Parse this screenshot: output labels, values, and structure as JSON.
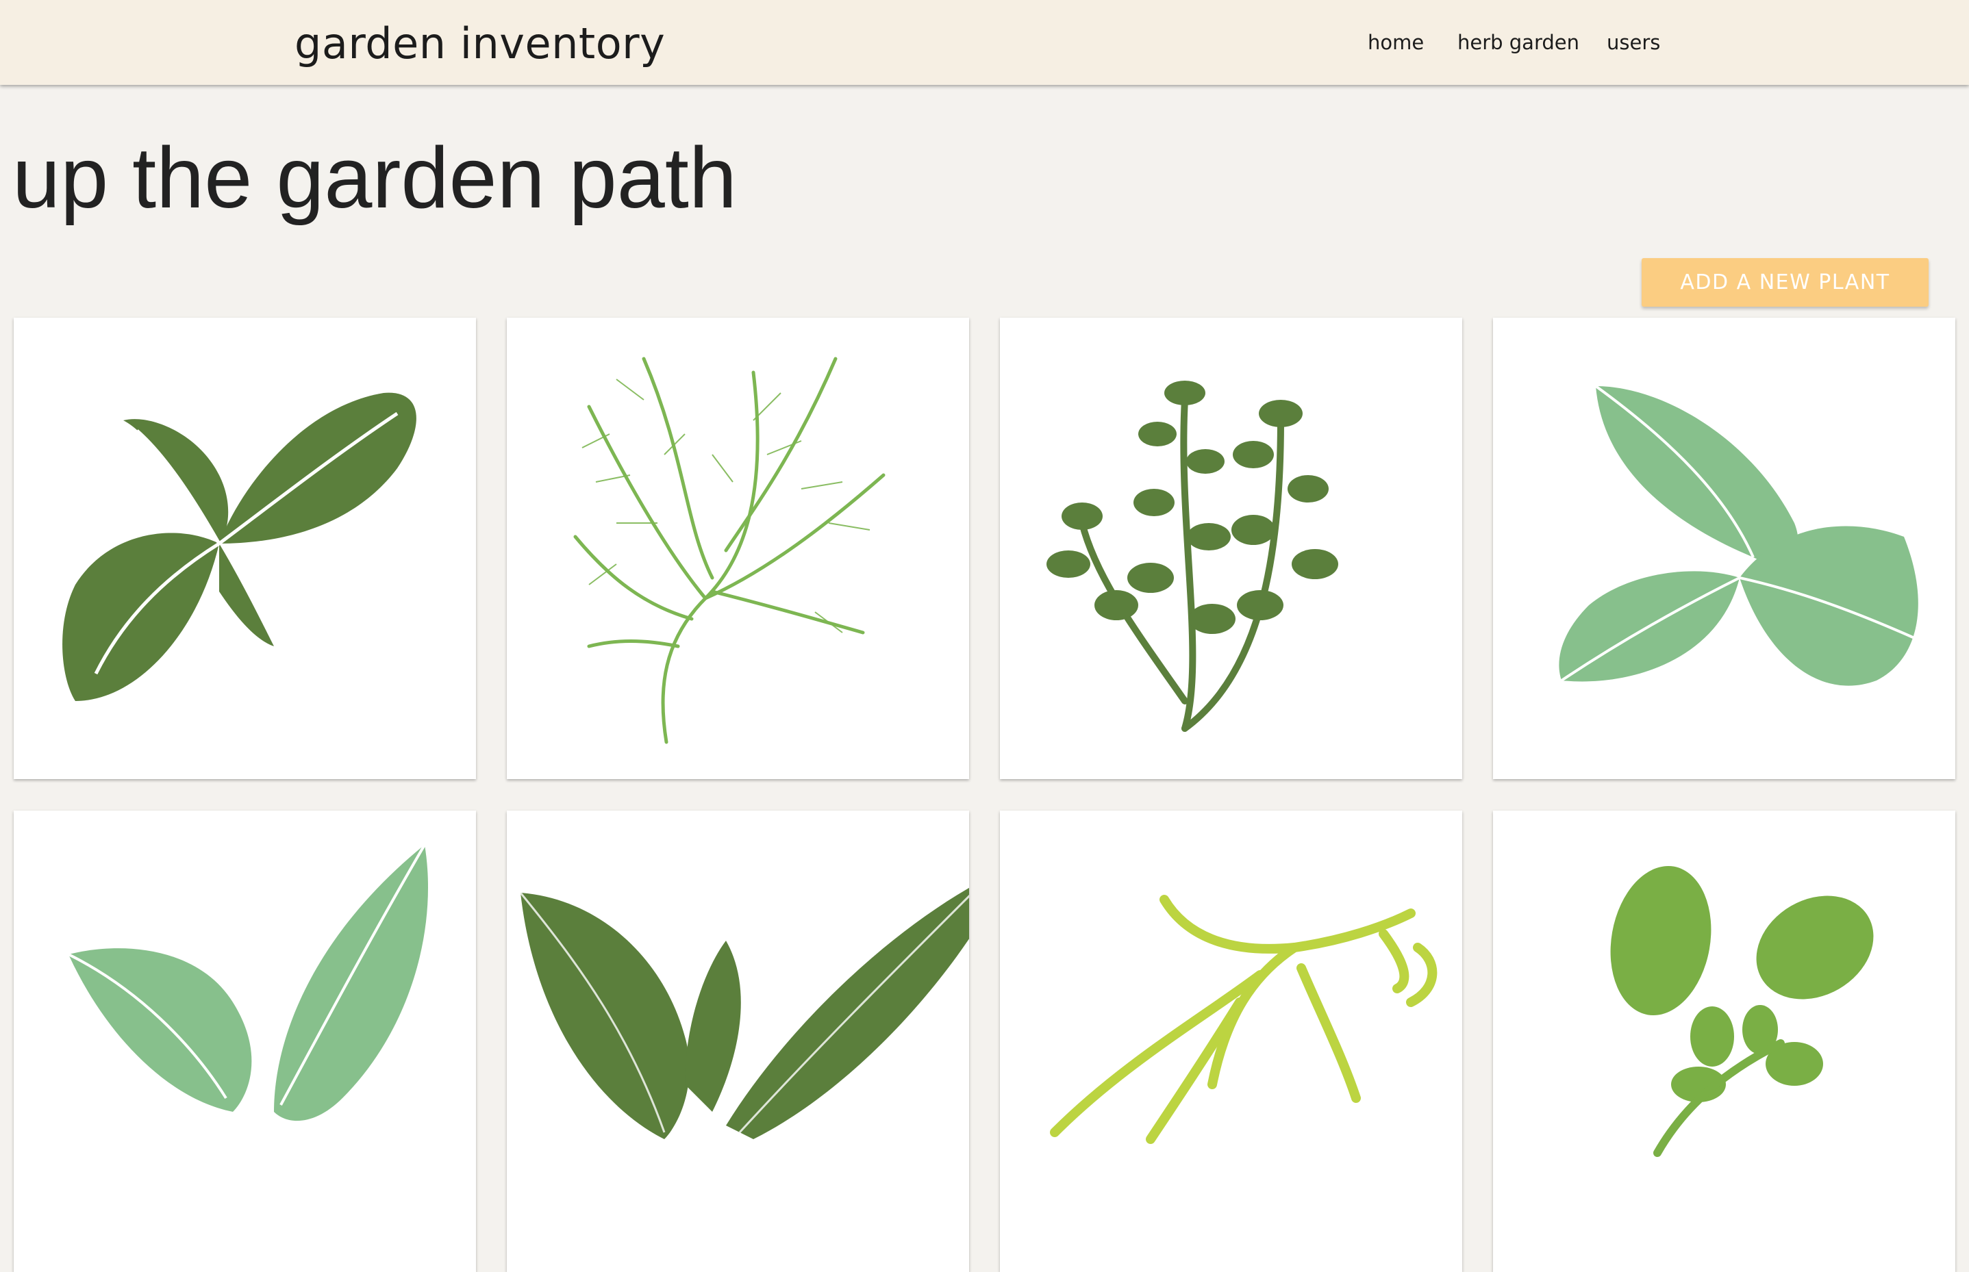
{
  "navbar": {
    "brand": "garden inventory",
    "links": [
      {
        "label": "home"
      },
      {
        "label": "herb garden"
      },
      {
        "label": "users"
      }
    ]
  },
  "main": {
    "title": "up the garden path",
    "add_button_label": "ADD A NEW PLANT"
  },
  "plants": [
    {
      "icon": "basil-icon",
      "color": "#5b7f3c"
    },
    {
      "icon": "dill-icon",
      "color": "#7db652"
    },
    {
      "icon": "thyme-icon",
      "color": "#5b7f3c"
    },
    {
      "icon": "mint-icon",
      "color": "#87c08c"
    },
    {
      "icon": "sage-icon",
      "color": "#87c08c"
    },
    {
      "icon": "bay-leaf-icon",
      "color": "#5b7f3c"
    },
    {
      "icon": "tarragon-icon",
      "color": "#bcd441"
    },
    {
      "icon": "oregano-icon",
      "color": "#7aaf45"
    }
  ],
  "colors": {
    "navbar_bg": "#f6efe3",
    "page_bg": "#f4f2ee",
    "accent_button": "#fbcd82"
  }
}
